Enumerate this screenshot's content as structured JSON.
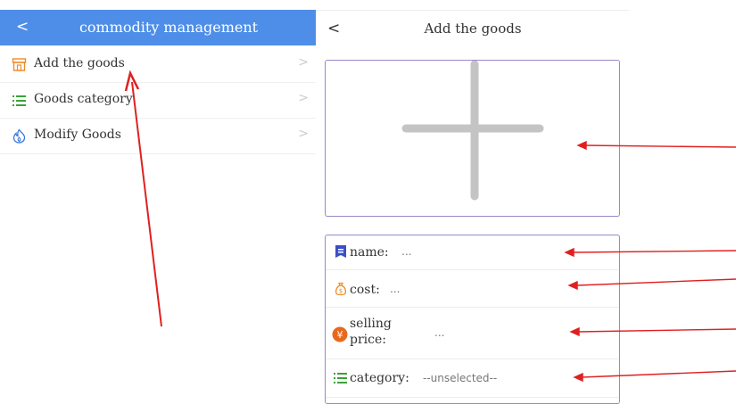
{
  "left_panel": {
    "header": {
      "back_glyph": "<",
      "title": "commodity management"
    },
    "menu": [
      {
        "icon": "shop-icon",
        "label": "Add the goods",
        "chevron": ">"
      },
      {
        "icon": "list-icon",
        "label": "Goods category",
        "chevron": ">"
      },
      {
        "icon": "flame-icon",
        "label": "Modify Goods",
        "chevron": ">"
      }
    ]
  },
  "right_panel": {
    "header": {
      "back_glyph": "<",
      "title": "Add the goods"
    },
    "upload": {
      "icon": "plus-icon"
    },
    "fields": [
      {
        "icon": "tag-icon",
        "label": "name:",
        "value": "..."
      },
      {
        "icon": "money-bag-icon",
        "label": "cost:",
        "value": "..."
      },
      {
        "icon": "yuan-icon",
        "label_line1": "selling",
        "label_line2": "price:",
        "value": "..."
      },
      {
        "icon": "list-icon",
        "label": "category:",
        "value": "--unselected--"
      }
    ]
  },
  "colors": {
    "header_blue": "#4e8ee8",
    "box_border": "#9b86c9",
    "annotation_red": "#e02020",
    "icon_orange": "#f08a24",
    "icon_green": "#3aa23a",
    "icon_navy": "#3b4fc4",
    "icon_blue": "#3a78d8",
    "plus_gray": "#c4c4c4"
  }
}
